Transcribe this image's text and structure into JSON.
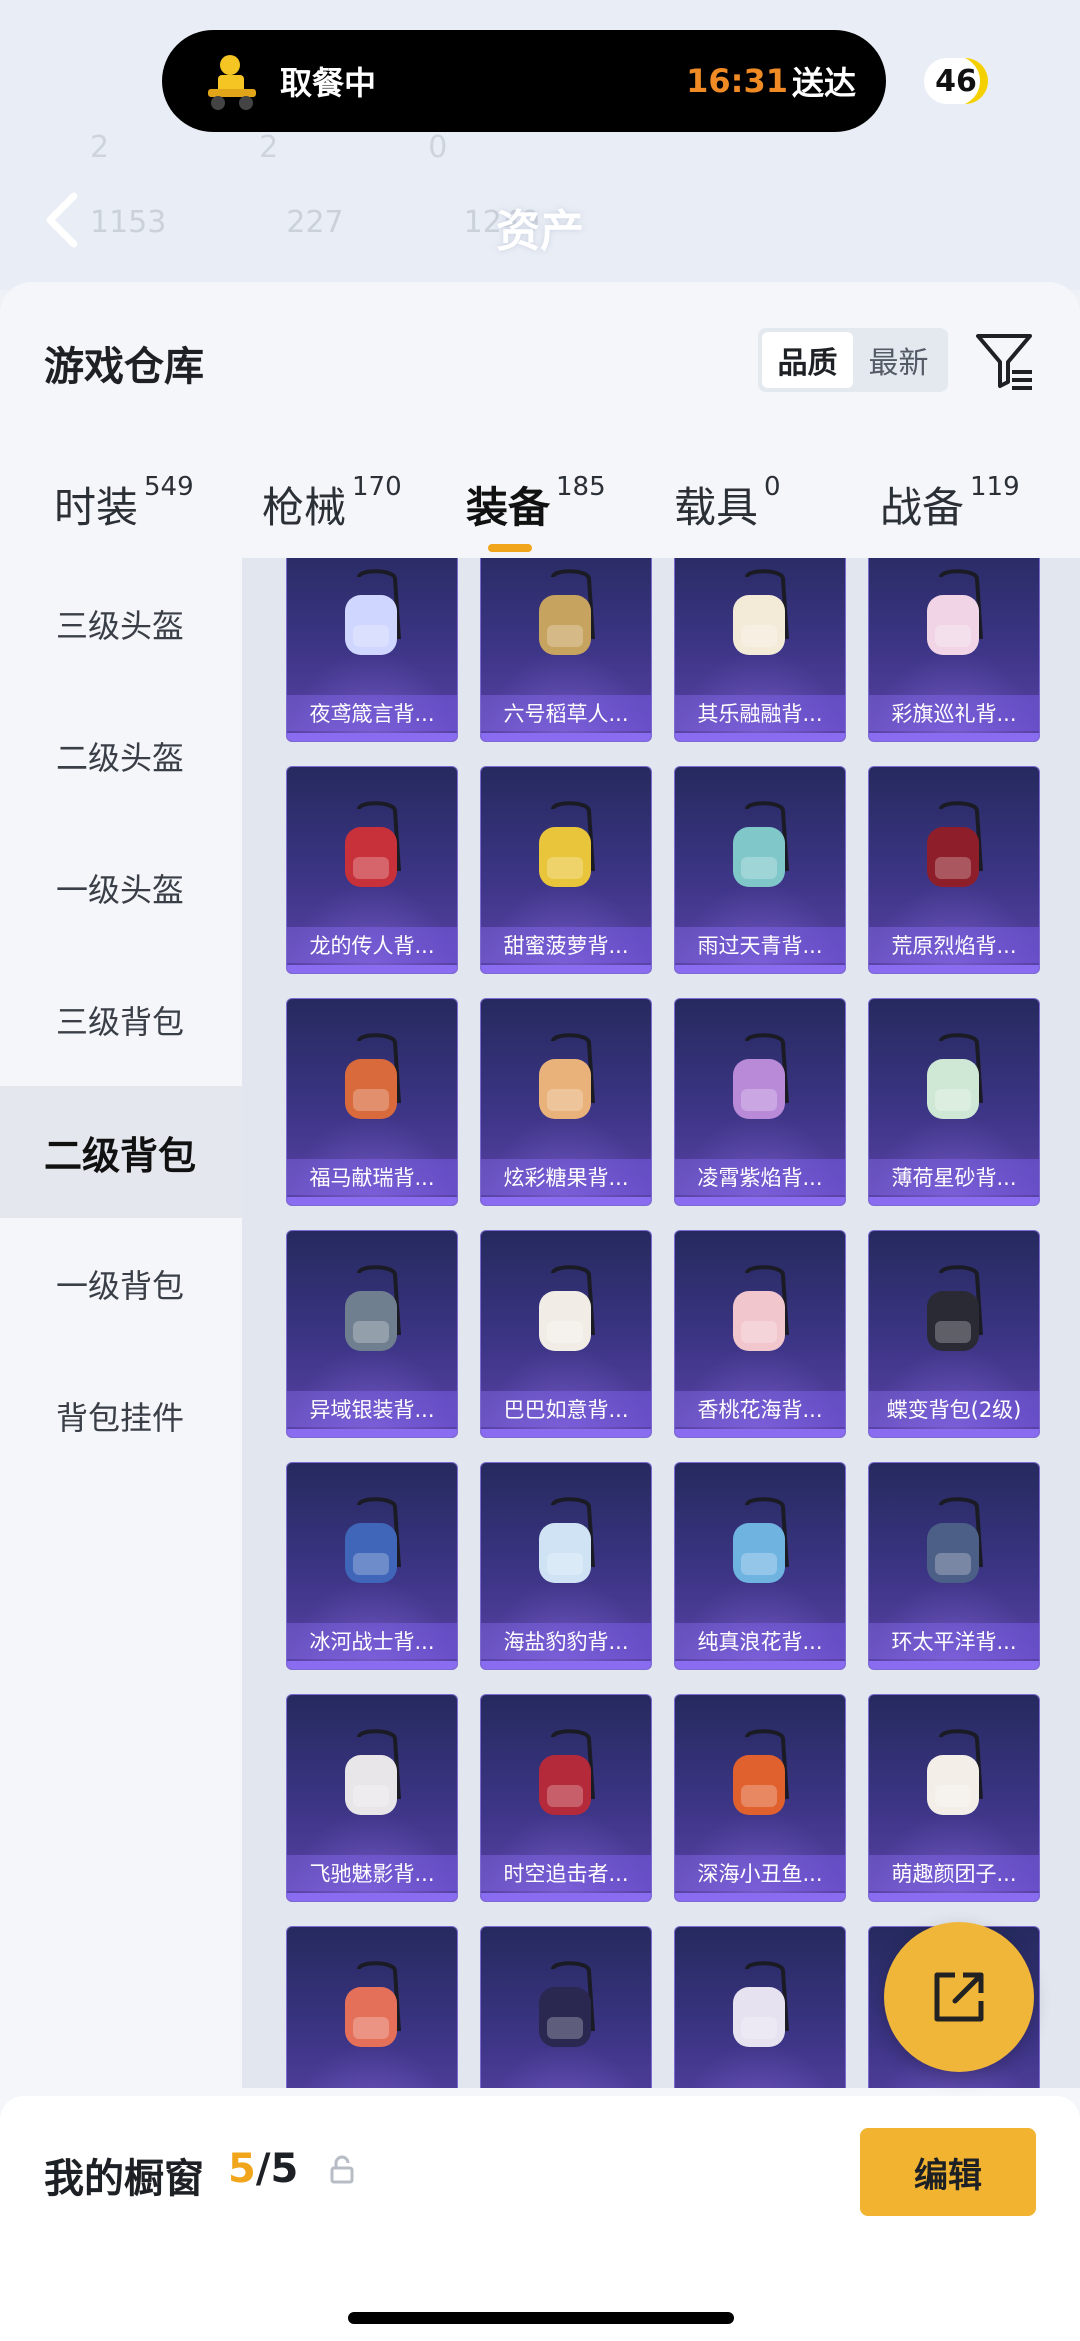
{
  "header": {
    "title": "资产",
    "faded_stats_row1": [
      "2",
      "2",
      "0"
    ],
    "faded_stats_row2": [
      "1153",
      "227",
      "1249"
    ]
  },
  "delivery_pill": {
    "status": "取餐中",
    "time": "16:31",
    "deliver_label": "送达"
  },
  "badge": {
    "count": "46"
  },
  "card": {
    "title": "游戏仓库",
    "sort_options": [
      {
        "label": "品质",
        "active": true
      },
      {
        "label": "最新",
        "active": false
      }
    ]
  },
  "tabs": [
    {
      "name": "时装",
      "count": "549"
    },
    {
      "name": "枪械",
      "count": "170"
    },
    {
      "name": "装备",
      "count": "185",
      "active": true
    },
    {
      "name": "载具",
      "count": "0"
    },
    {
      "name": "战备",
      "count": "119"
    }
  ],
  "sidebar": {
    "items": [
      {
        "label": "三级头盔"
      },
      {
        "label": "二级头盔"
      },
      {
        "label": "一级头盔"
      },
      {
        "label": "三级背包"
      },
      {
        "label": "二级背包",
        "active": true
      },
      {
        "label": "一级背包"
      },
      {
        "label": "背包挂件"
      }
    ]
  },
  "items": [
    {
      "label": "夜鸢箴言背...",
      "color": "#cfd6ff"
    },
    {
      "label": "六号稻草人...",
      "color": "#c7a360"
    },
    {
      "label": "其乐融融背...",
      "color": "#f3ead8"
    },
    {
      "label": "彩旗巡礼背...",
      "color": "#f1d4e6"
    },
    {
      "label": "龙的传人背...",
      "color": "#c9313a"
    },
    {
      "label": "甜蜜菠萝背...",
      "color": "#e8c53a"
    },
    {
      "label": "雨过天青背...",
      "color": "#7fc7c9"
    },
    {
      "label": "荒原烈焰背...",
      "color": "#8e1f2a"
    },
    {
      "label": "福马献瑞背...",
      "color": "#d86a3c"
    },
    {
      "label": "炫彩糖果背...",
      "color": "#e8b27a"
    },
    {
      "label": "凌霄紫焰背...",
      "color": "#b98ad8"
    },
    {
      "label": "薄荷星砂背...",
      "color": "#cfe8d6"
    },
    {
      "label": "异域银装背...",
      "color": "#6f7f8f"
    },
    {
      "label": "巴巴如意背...",
      "color": "#f2ece6"
    },
    {
      "label": "香桃花海背...",
      "color": "#f1c6cc"
    },
    {
      "label": "蝶变背包(2级)",
      "color": "#2a2a35"
    },
    {
      "label": "冰河战士背...",
      "color": "#3f66b8"
    },
    {
      "label": "海盐豹豹背...",
      "color": "#cfe3f4"
    },
    {
      "label": "纯真浪花背...",
      "color": "#6fb3e0"
    },
    {
      "label": "环太平洋背...",
      "color": "#4c5f86"
    },
    {
      "label": "飞驰魅影背...",
      "color": "#e9e6ea"
    },
    {
      "label": "时空追击者...",
      "color": "#b52a3a"
    },
    {
      "label": "深海小丑鱼...",
      "color": "#e0602e"
    },
    {
      "label": "萌趣颜团子...",
      "color": "#f3efe8"
    },
    {
      "label": "",
      "color": "#e5705a"
    },
    {
      "label": "",
      "color": "#2a2750"
    },
    {
      "label": "",
      "color": "#e6e2f0"
    },
    {
      "label": "",
      "color": "#3a1f2a"
    }
  ],
  "bottom": {
    "window_label": "我的橱窗",
    "window_current": "5",
    "window_total": "/5",
    "edit_label": "编辑"
  }
}
